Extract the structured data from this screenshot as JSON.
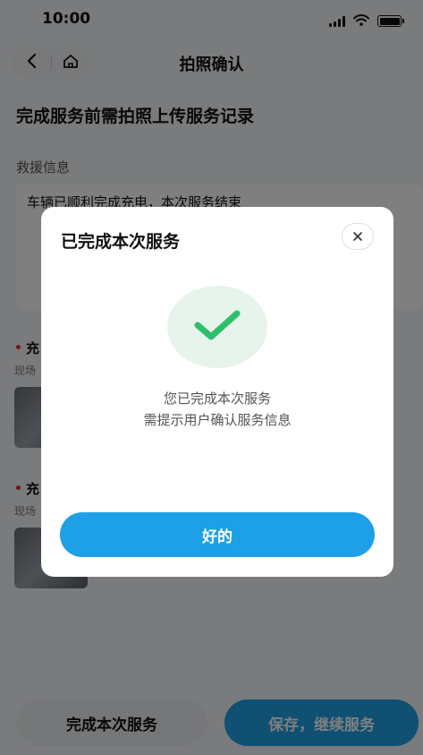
{
  "status_bar": {
    "time": "10:00"
  },
  "header": {
    "title": "拍照确认"
  },
  "page": {
    "heading": "完成服务前需拍照上传服务记录",
    "rescue_label": "救援信息",
    "rescue_text": "车辆已顺利完成充电，本次服务结束",
    "photo_sections": [
      {
        "title": "充",
        "subtitle": "现场"
      },
      {
        "title": "充",
        "subtitle": "现场"
      }
    ]
  },
  "bottom_bar": {
    "complete_label": "完成本次服务",
    "save_label": "保存，继续服务"
  },
  "modal": {
    "title": "已完成本次服务",
    "message_line1": "您已完成本次服务",
    "message_line2": "需提示用户确认服务信息",
    "ok_label": "好的"
  },
  "colors": {
    "accent": "#1ea0e6",
    "success": "#2fbf6b",
    "success_bg": "#e6f4ec"
  },
  "icons": {
    "back": "chevron-left-icon",
    "home": "home-icon",
    "close": "close-icon",
    "success": "checkmark-icon"
  }
}
